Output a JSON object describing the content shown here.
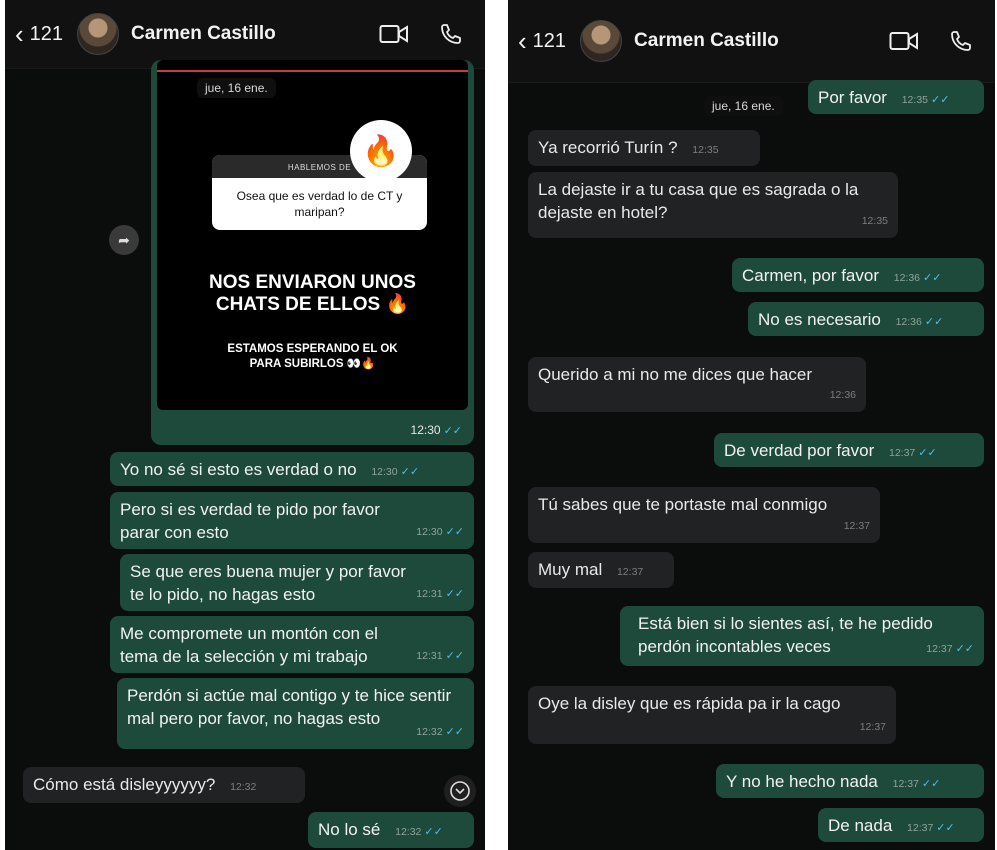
{
  "left": {
    "header": {
      "back_count": "121",
      "contact_name": "Carmen Castillo"
    },
    "date_chip": "jue, 16 ene.",
    "story": {
      "question_header": "HABLEMOS DE",
      "question_text": "Osea que es verdad lo de CT y maripan?",
      "fire_emoji": "🔥",
      "headline_line1": "NOS ENVIARON UNOS",
      "headline_line2": "CHATS DE ELLOS 🔥",
      "sub_line1": "ESTAMOS ESPERANDO EL OK",
      "sub_line2": "PARA SUBIRLOS 👀🔥",
      "time": "12:30"
    },
    "messages": [
      {
        "text": "Yo no sé si esto es verdad o no",
        "time": "12:30"
      },
      {
        "text": "Pero si es verdad te pido por favor parar con esto",
        "time": "12:30"
      },
      {
        "text": "Se que eres buena mujer y por favor te lo pido, no hagas esto",
        "time": "12:31"
      },
      {
        "text": "Me compromete un montón con el tema de la selección y mi trabajo",
        "time": "12:31"
      },
      {
        "text": "Perdón si actúe mal contigo y te hice sentir mal pero por favor, no hagas esto",
        "time": "12:32"
      },
      {
        "text": "Cómo está disleyyyyyy?",
        "time": "12:32"
      },
      {
        "text": "No lo sé",
        "time": "12:32"
      }
    ]
  },
  "right": {
    "header": {
      "back_count": "121",
      "contact_name": "Carmen Castillo"
    },
    "date_chip": "jue, 16 ene.",
    "messages": [
      {
        "text": "Por favor",
        "time": "12:35"
      },
      {
        "text": "Ya recorrió Turín ?",
        "time": "12:35"
      },
      {
        "text": "La dejaste ir a tu casa que es sagrada o la dejaste en hotel?",
        "time": "12:35"
      },
      {
        "text": "Carmen, por favor",
        "time": "12:36"
      },
      {
        "text": "No es necesario",
        "time": "12:36"
      },
      {
        "text": "Querido a mi no me dices que hacer",
        "time": "12:36"
      },
      {
        "text": "De verdad por favor",
        "time": "12:37"
      },
      {
        "text": "Tú sabes que te portaste mal conmigo",
        "time": "12:37"
      },
      {
        "text": "Muy mal",
        "time": "12:37"
      },
      {
        "text": "Está bien si lo sientes así, te he pedido perdón incontables veces",
        "time": "12:37"
      },
      {
        "text": "Oye la disley que es rápida pa ir la cago",
        "time": "12:37"
      },
      {
        "text": "Y no he hecho nada",
        "time": "12:37"
      },
      {
        "text": "De nada",
        "time": "12:37"
      }
    ]
  },
  "icons": {
    "read": "double-check-icon",
    "video": "video-icon",
    "call": "phone-icon"
  },
  "colors": {
    "outgoing": "#1d4a3b",
    "incoming": "#202223",
    "background": "#0b0c0c"
  }
}
